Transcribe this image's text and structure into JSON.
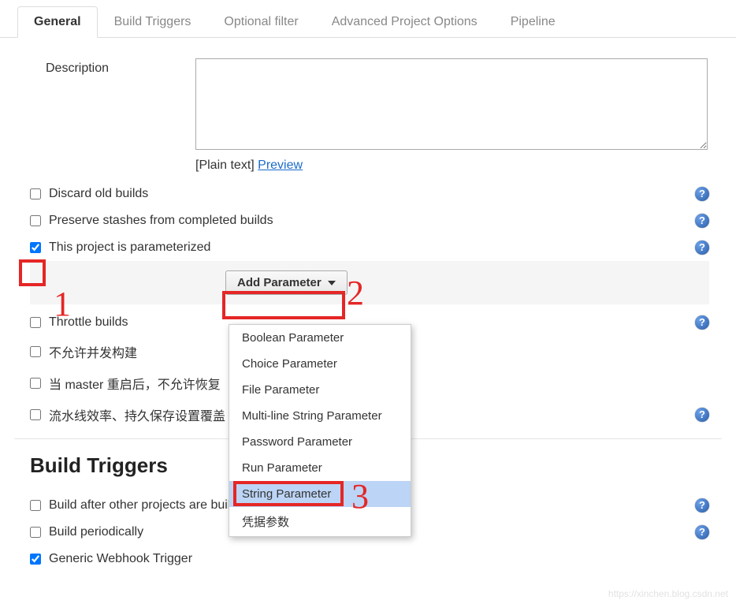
{
  "tabs": [
    {
      "label": "General",
      "active": true
    },
    {
      "label": "Build Triggers",
      "active": false
    },
    {
      "label": "Optional filter",
      "active": false
    },
    {
      "label": "Advanced Project Options",
      "active": false
    },
    {
      "label": "Pipeline",
      "active": false
    }
  ],
  "description": {
    "label": "Description",
    "value": "",
    "plain_text": "[Plain text]",
    "preview": "Preview"
  },
  "general_options": [
    {
      "label": "Discard old builds",
      "checked": false,
      "help": true
    },
    {
      "label": "Preserve stashes from completed builds",
      "checked": false,
      "help": true
    },
    {
      "label": "This project is parameterized",
      "checked": true,
      "help": true
    }
  ],
  "add_parameter": {
    "button_label": "Add Parameter",
    "options": [
      "Boolean Parameter",
      "Choice Parameter",
      "File Parameter",
      "Multi-line String Parameter",
      "Password Parameter",
      "Run Parameter",
      "String Parameter",
      "凭据参数"
    ],
    "highlighted_index": 6
  },
  "more_options": [
    {
      "label": "Throttle builds",
      "checked": false,
      "help": true
    },
    {
      "label": "不允许并发构建",
      "checked": false,
      "help": false
    },
    {
      "label": "当 master 重启后，不允许恢复",
      "checked": false,
      "help": false
    },
    {
      "label": "流水线效率、持久保存设置覆盖",
      "checked": false,
      "help": true
    }
  ],
  "build_triggers": {
    "header": "Build Triggers",
    "options": [
      {
        "label": "Build after other projects are built",
        "checked": false,
        "help": true
      },
      {
        "label": "Build periodically",
        "checked": false,
        "help": true
      },
      {
        "label": "Generic Webhook Trigger",
        "checked": true,
        "help": false
      }
    ]
  },
  "annotations": {
    "n1": "1",
    "n2": "2",
    "n3": "3"
  },
  "watermark": "https://xinchen.blog.csdn.net"
}
